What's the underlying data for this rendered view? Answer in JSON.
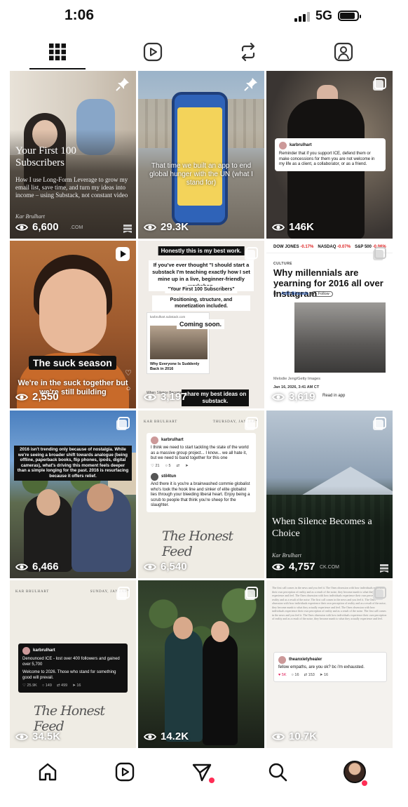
{
  "status_bar": {
    "time": "1:06",
    "network": "5G"
  },
  "tabs": [
    {
      "name": "grid",
      "icon": "grid-icon",
      "active": true
    },
    {
      "name": "reels",
      "icon": "reels-icon"
    },
    {
      "name": "reposts",
      "icon": "repost-icon"
    },
    {
      "name": "tagged",
      "icon": "tagged-icon"
    }
  ],
  "tiles": [
    {
      "type": "pinned-article",
      "title": "Your First 100 Subscribers",
      "description": "How I use Long-Form Leverage to grow my email list, save time, and turn my ideas into income – using Substack, not constant video",
      "author": "Kar Brulhart",
      "domain": ".COM",
      "views": "6,600"
    },
    {
      "type": "pinned-photo",
      "caption": "That time we built an app to end global hunger with the UN (what I stand for)",
      "views": "29.3K"
    },
    {
      "type": "carousel",
      "tweet_author": "karbrulhart",
      "tweet_text": "Reminder that if you support ICE, defend them or make concessions for them you are not welcome in my life as a client, a collaborator, or as a friend.",
      "views": "146K"
    },
    {
      "type": "reel",
      "label": "The suck season",
      "subtitle": "We're in the suck together but we're still building",
      "views": "2,550"
    },
    {
      "type": "carousel",
      "pill1": "Honestly this is my best work.",
      "pill2": "If you've ever thought \"I should start a substack I'm teaching exactly how I set mine up in a live, beginner-friendly workshop.",
      "pill3": "\"Your First 100 Subscribers\"",
      "pill4": "Positioning, structure, and monetization included.",
      "mock_url": "karbrulhart.substack.com",
      "mock_headline": "Why Everyone Is Suddenly Back in 2016",
      "mock_footer": "When Silence Becomes a Choice",
      "coming_soon": "Coming soon.",
      "best_ideas": "share my best ideas on substack.",
      "views": "3,197"
    },
    {
      "type": "carousel",
      "ticker": [
        {
          "label": "DOW JONES",
          "change": "-0.17%"
        },
        {
          "label": "NASDAQ",
          "change": "-0.07%"
        },
        {
          "label": "S&P 500",
          "change": "-0.06%"
        }
      ],
      "section": "CULTURE",
      "headline": "Why millennials are yearning for 2016 all over Instagram",
      "byline_prefix": "By",
      "byline_author": "Aditi Bharade",
      "follow_label": "+ Follow",
      "photo_credit": "Melodie Jeng/Getty Images",
      "date": "Jan 16, 2026, 3:41 AM CT",
      "bar_text": "Read in app",
      "views": "3,619"
    },
    {
      "type": "carousel",
      "overlay_text": "2016 isn't trending only because of nostalgia. While we're seeing a broader shift towards analogue (being offline, paperback books, flip phones, ipods, digital cameras), what's driving this moment feels deeper than a simple longing for the past. 2016 is resurfacing because it offers relief.",
      "views": "6,466"
    },
    {
      "type": "carousel",
      "header_left": "KAR BRULHART",
      "header_right": "THURSDAY, JANUARY",
      "tweet_author": "karbrulhart",
      "tweet_text": "I think we need to start tackling the state of the world as a massive group project... I know... we all hate it, but we need to band together for this one",
      "tweet_stats": [
        "21",
        "5"
      ],
      "reply_author": "stil4tun",
      "reply_text": "And there it is you're a brainwashed commie globalist who's took the hook line and sinker of elite globalist lies through your bleeding liberal heart. Enjoy being a scrub to people that think you're sheep for the slaughter.",
      "signature": "The Honest Feed",
      "views": "6,540"
    },
    {
      "type": "article",
      "title": "When Silence Becomes a Choice",
      "author": "Kar Brulhart",
      "domain": "CK.COM",
      "views": "4,757"
    },
    {
      "type": "carousel",
      "header_left": "KAR BRULHART",
      "header_right": "SUNDAY, JANUARY",
      "tweet_author": "karbrulhart",
      "tweet_text_1": "Denounced ICE - lost over 400 followers and gained over 5,700",
      "tweet_text_2": "Welcome to 2026. Those who stand for something good will prevail.",
      "tweet_stats": [
        "25.9K",
        "149",
        "499",
        "16"
      ],
      "signature": "The Honest Feed",
      "views": "34.5K"
    },
    {
      "type": "carousel",
      "views": "14.2K"
    },
    {
      "type": "carousel",
      "tweet_author": "theanxietyhealer",
      "tweet_text": "fellow empaths, are you ok? bc i'm exhausted.",
      "tweet_stats": [
        "5K",
        "16",
        "153",
        "16"
      ],
      "body_text": "The first call comes in the news and you feel it. The Ones obsession with how individuals experience their own perception of reality and as a result of the noise, they become numb to what they actually experience and feel. The Ones obsession with how individuals experience their own perception of reality and as a result of the noise. The first call comes in the news and you feel it. The Ones obsession with how individuals experience their own perception of reality and as a result of the noise, they become numb to what they actually experience and feel. The Ones obsession with how individuals experience their own perception of reality and as a result of the noise. The first call comes in the news and you feel it. The Ones obsession with how individuals experience their own perception of reality and as a result of the noise, they become numb to what they actually experience and feel.",
      "views": "10.7K"
    }
  ],
  "bottom_nav": [
    {
      "name": "home",
      "icon": "home-icon"
    },
    {
      "name": "reels",
      "icon": "reels-icon"
    },
    {
      "name": "messages",
      "icon": "send-icon",
      "badge": true
    },
    {
      "name": "search",
      "icon": "search-icon"
    },
    {
      "name": "profile",
      "icon": "avatar",
      "badge": true
    }
  ],
  "colors": {
    "badge": "#ff2d55",
    "link": "#2451a6",
    "negative": "#dd2222"
  }
}
